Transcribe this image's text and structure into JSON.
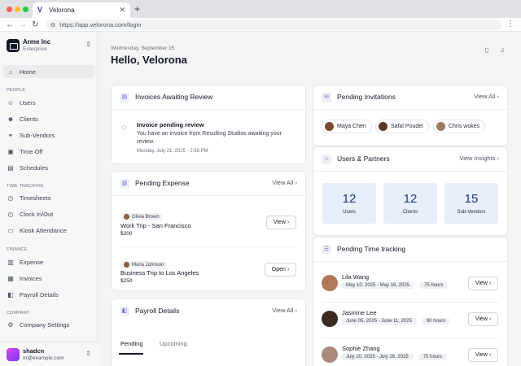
{
  "browser": {
    "tab_title": "Velorona",
    "url": "https://app.velorona.com/login"
  },
  "sidebar": {
    "org_name": "Arme Inc",
    "org_plan": "Enterprice",
    "home": "Home",
    "sections": {
      "people": "PEOPLE",
      "time_tracking": "TIME TRACKING",
      "finance": "FINANCE",
      "company": "COMPANY"
    },
    "items": {
      "users": "Users",
      "clients": "Clients",
      "sub_vendors": "Sub-Vendors",
      "time_off": "Time Off",
      "schedules": "Schedules",
      "timesheets": "Timesheets",
      "clock": "Clock In/Out",
      "kiosk": "Kiosk Attendance",
      "expense": "Expense",
      "invoices": "Invoices",
      "payroll": "Payroll Details",
      "company_settings": "Company Settings"
    },
    "user": {
      "name": "shadcn",
      "email": "m@example.com"
    }
  },
  "header": {
    "date": "Wednesday, September 15",
    "greeting": "Hello, Velorona"
  },
  "invoices_card": {
    "title": "Invoices Awaiting Review",
    "item_title": "Invoice pending review",
    "item_body": "You have an invoice from Resulting Studios awaiting your review.",
    "item_time": "Monday, July 21, 2025 · 2:58 PM"
  },
  "expense_card": {
    "title": "Pending Expense",
    "view_all": "View All",
    "items": [
      {
        "person": "Olivia Brown",
        "trip": "Work Trip - San Francisco",
        "amount": "$200",
        "action": "View"
      },
      {
        "person": "Maria Johnson",
        "trip": "Business Trip to Los Angeles",
        "amount": "$250",
        "action": "Open"
      }
    ]
  },
  "payroll_card": {
    "title": "Payroll Details",
    "view_all": "View All",
    "tabs": [
      "Pending",
      "Upcoming"
    ]
  },
  "invitations_card": {
    "title": "Pending Invitations",
    "view_all": "View All",
    "people": [
      "Maya Chen",
      "Safal Poudel",
      "Chris wokes"
    ]
  },
  "partners_card": {
    "title": "Users & Partners",
    "view_insights": "View Insights",
    "stats": [
      {
        "value": "12",
        "label": "Users"
      },
      {
        "value": "12",
        "label": "Clients"
      },
      {
        "value": "15",
        "label": "Sub-Vendors"
      }
    ]
  },
  "timetracking_card": {
    "title": "Pending Time tracking",
    "rows": [
      {
        "name": "Lila Wang",
        "range": "May 10, 2025 - May 16, 2025",
        "hours": "75 hours",
        "action": "View"
      },
      {
        "name": "Jasmine Lee",
        "range": "June 05, 2025 - June 11, 2025",
        "hours": "90 hours",
        "action": "View"
      },
      {
        "name": "Sophie Zhang",
        "range": "July 20, 2025 - July 26, 2025",
        "hours": "75 hours",
        "action": "View"
      }
    ]
  },
  "colors": {
    "accent": "#1e3a8a",
    "stat_bg": "#e8eefa",
    "sidebar_bg": "#f7f7f8"
  }
}
